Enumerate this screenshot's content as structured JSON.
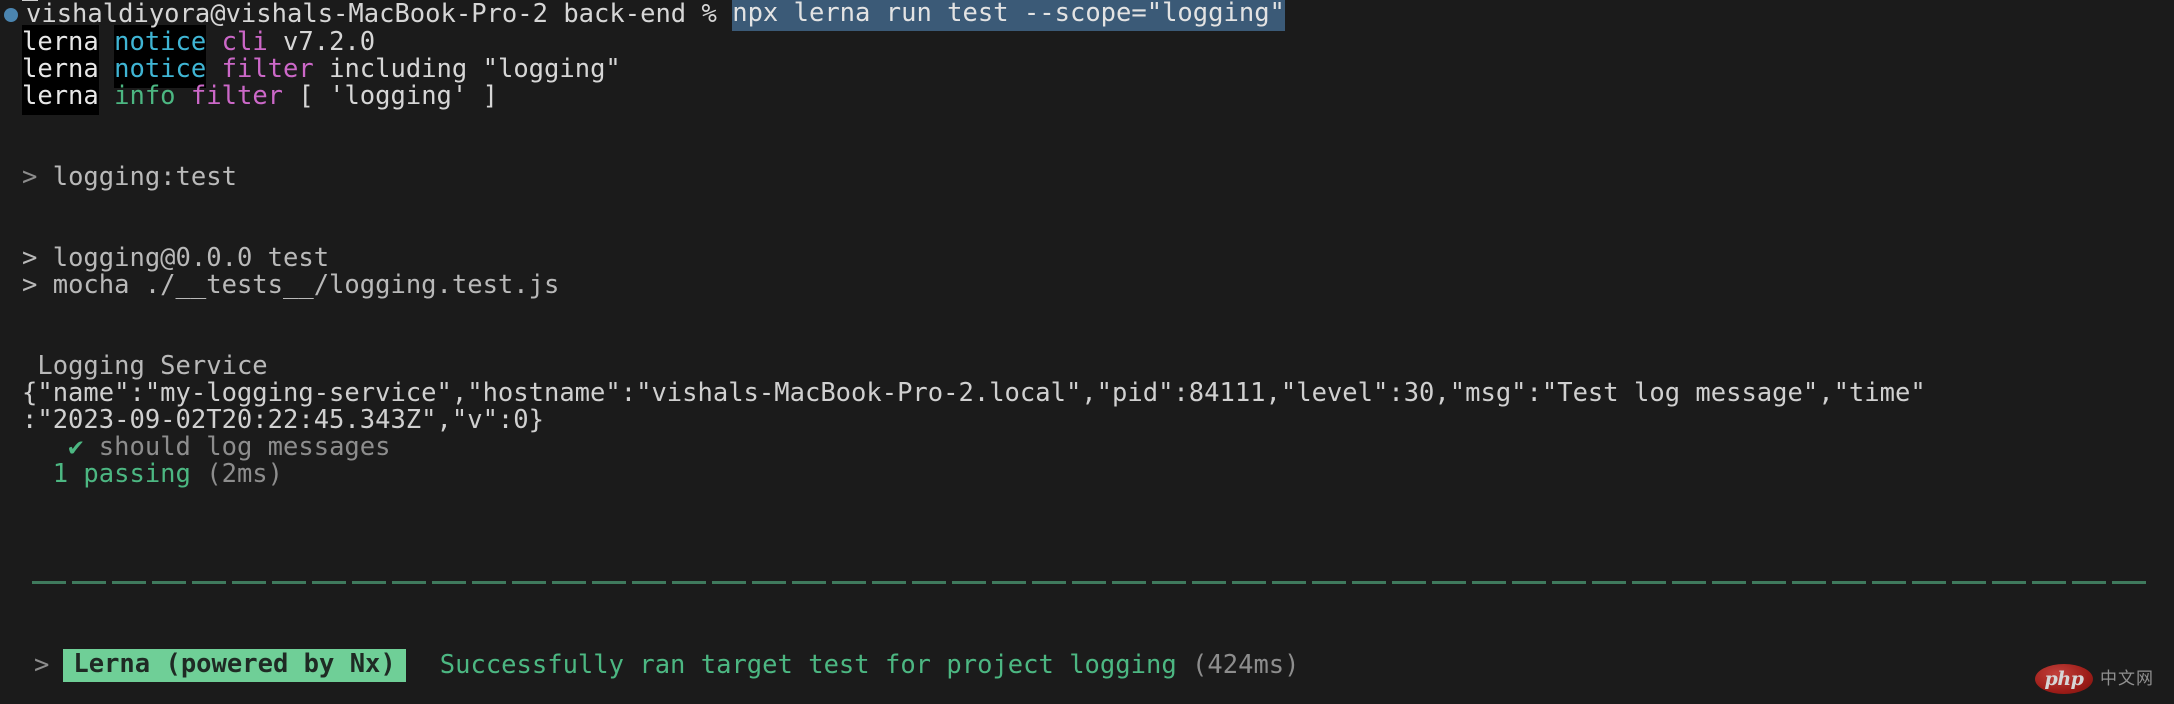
{
  "terminal": {
    "background_color": "#1b1b1b",
    "foreground_color": "#d6d6d6",
    "selection_color": "#3b5a77",
    "accent_green": "#4cb782",
    "accent_cyan": "#3fb5d4",
    "accent_magenta": "#cc68c8",
    "badge_green": "#6fcf97"
  },
  "prompt": {
    "marker": "bullet-icon",
    "user_host_path": "vishaldiyora@vishals-MacBook-Pro-2 back-end %",
    "command": "npx lerna run test --scope=\"logging\""
  },
  "lerna_log": [
    {
      "tag": "lerna",
      "level": "notice",
      "level_color": "cyan",
      "keyword": "cli",
      "rest": " v7.2.0"
    },
    {
      "tag": "lerna",
      "level": "notice",
      "level_color": "cyan",
      "keyword": "filter",
      "rest": " including \"logging\""
    },
    {
      "tag": "lerna",
      "level": "info",
      "level_color": "green",
      "keyword": "filter",
      "rest": " [ 'logging' ]"
    }
  ],
  "task_header": {
    "arrow": ">",
    "target": "logging:test"
  },
  "npm_script": {
    "line1_arrow": ">",
    "line1_text": "logging@0.0.0 test",
    "line2_arrow": ">",
    "line2_text": "mocha ./__tests__/logging.test.js"
  },
  "mocha": {
    "suite_title": "Logging Service",
    "json_log_part1": "{\"name\":\"my-logging-service\",\"hostname\":\"vishals-MacBook-Pro-2.local\",\"pid\":84111,\"level\":30,\"msg\":\"Test log message\",\"time\"",
    "json_log_part2": ":\"2023-09-02T20:22:45.343Z\",\"v\":0}",
    "test_check": "✔",
    "test_name": "should log messages",
    "passing_count": "1 passing",
    "passing_time": "(2ms)"
  },
  "footer": {
    "arrow": ">",
    "badge": "Lerna (powered by Nx)",
    "message": "Successfully ran target test for project logging",
    "duration": "(424ms)"
  },
  "watermark": {
    "logo_text": "php",
    "site_text": "中文网"
  }
}
